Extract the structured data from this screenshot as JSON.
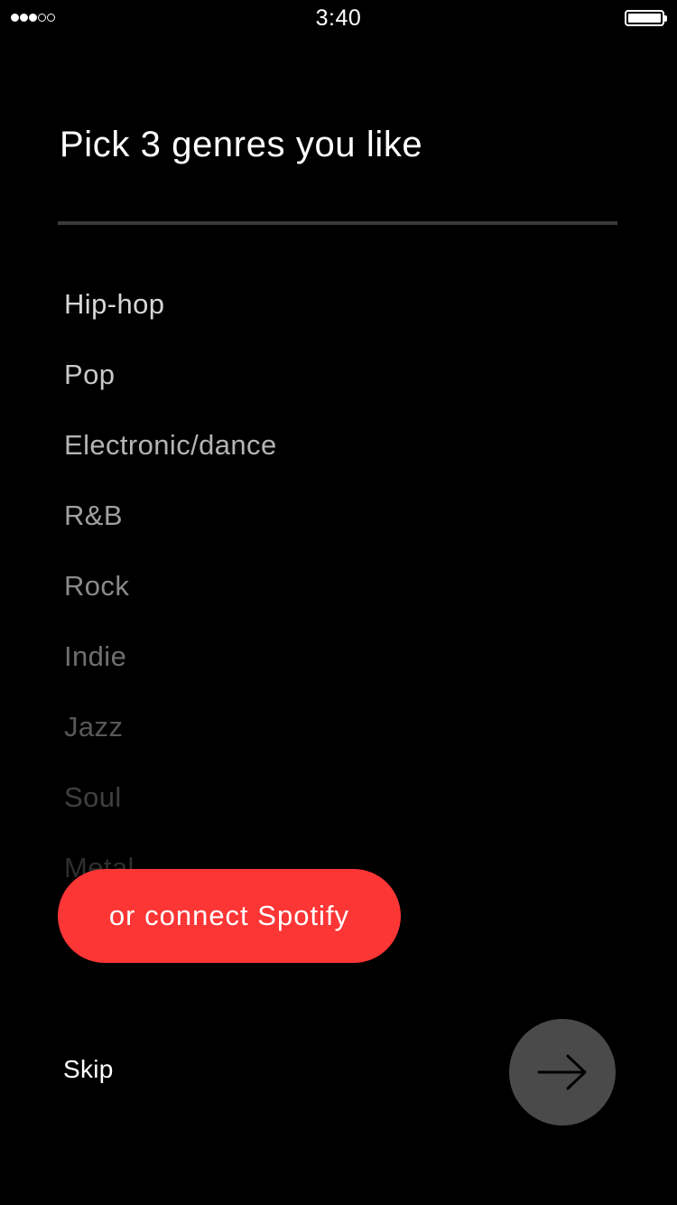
{
  "status_bar": {
    "time": "3:40",
    "signal_filled": 3,
    "signal_total": 5,
    "battery_level": 1.0
  },
  "title": "Pick 3 genres you like",
  "genres": [
    {
      "label": "Hip-hop",
      "color": "#d6d6d6"
    },
    {
      "label": "Pop",
      "color": "#c9c9c9"
    },
    {
      "label": "Electronic/dance",
      "color": "#b4b4b4"
    },
    {
      "label": "R&B",
      "color": "#a0a0a0"
    },
    {
      "label": "Rock",
      "color": "#8a8a8a"
    },
    {
      "label": "Indie",
      "color": "#6f6f6f"
    },
    {
      "label": "Jazz",
      "color": "#575757"
    },
    {
      "label": "Soul",
      "color": "#404040"
    },
    {
      "label": "Metal",
      "color": "#2e2e2e"
    }
  ],
  "spotify_button": {
    "label": "or connect Spotify",
    "color": "#fc3535"
  },
  "skip_label": "Skip",
  "next_button": {
    "icon": "arrow-right-icon",
    "color": "#4a4a4a"
  }
}
